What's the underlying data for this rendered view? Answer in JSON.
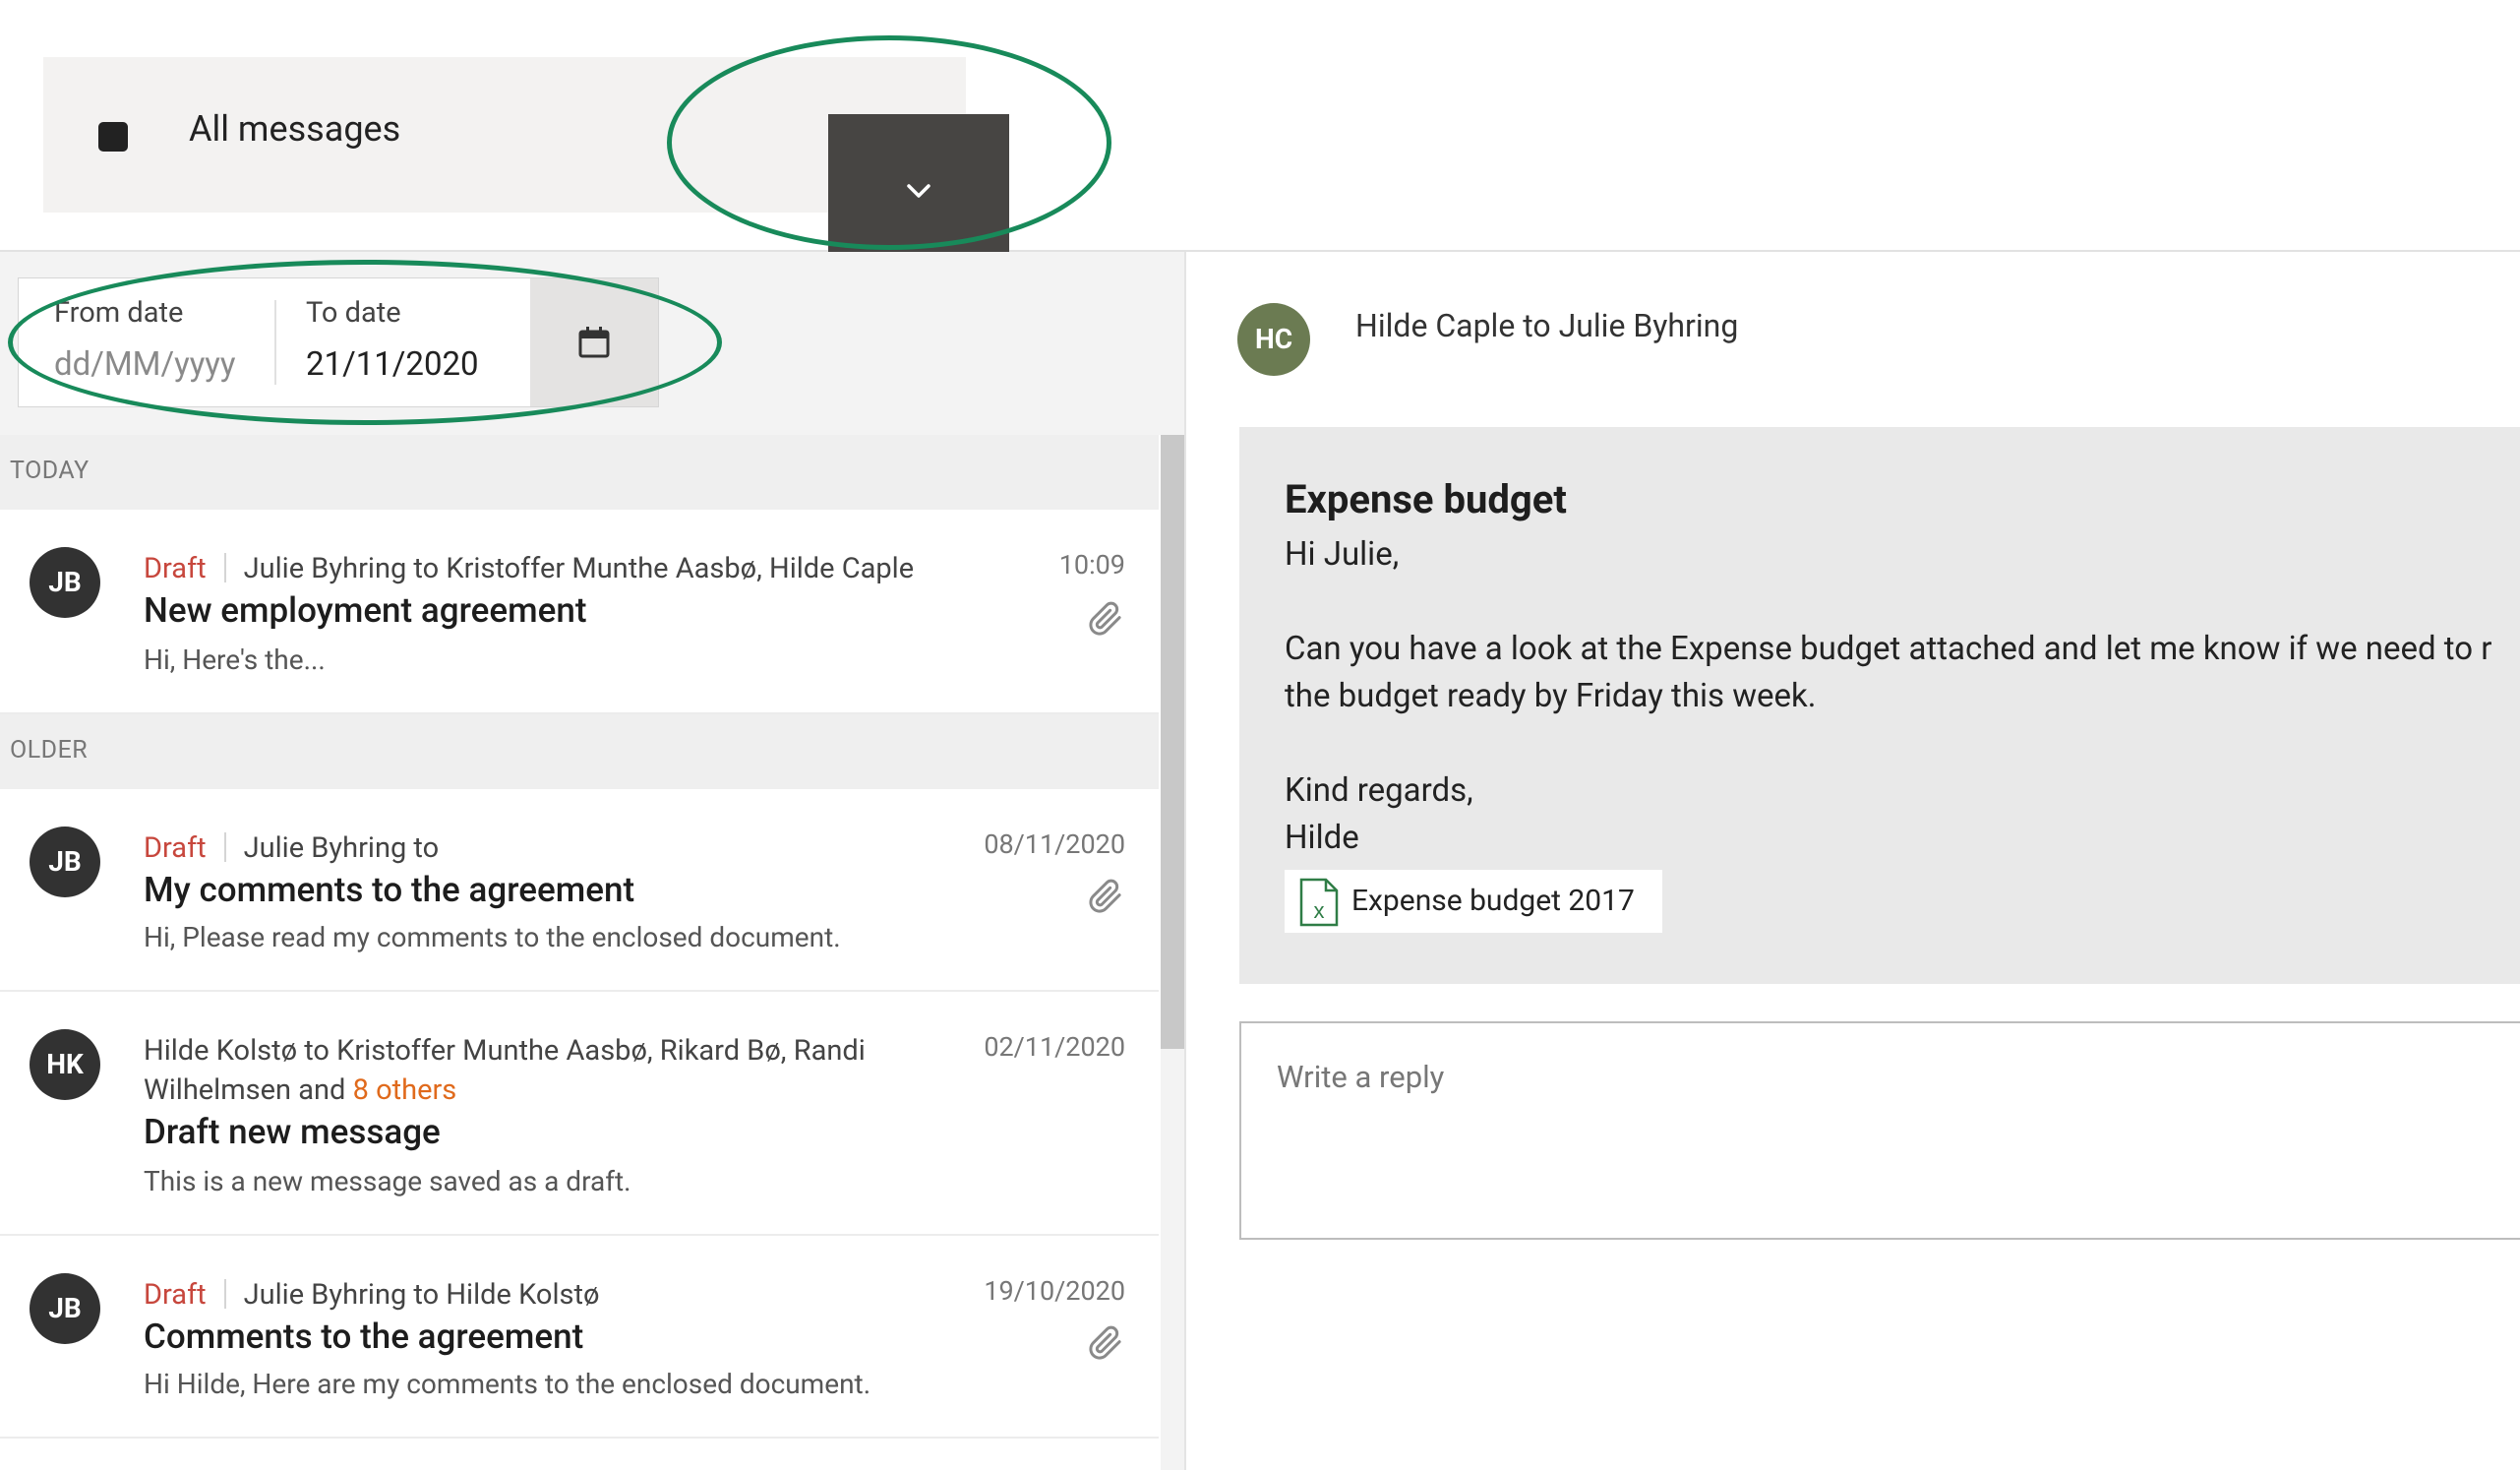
{
  "filter": {
    "label": "All messages"
  },
  "dates": {
    "from_label": "From date",
    "from_placeholder": "dd/MM/yyyy",
    "to_label": "To date",
    "to_value": "21/11/2020"
  },
  "sections": {
    "today": "TODAY",
    "older": "OLDER"
  },
  "messages": [
    {
      "initials": "JB",
      "tag": "Draft",
      "participants": "Julie Byhring to Kristoffer Munthe Aasbø, Hilde Caple",
      "subject": "New employment agreement",
      "preview": "Hi, Here's the...",
      "time": "10:09"
    },
    {
      "initials": "JB",
      "tag": "Draft",
      "participants": "Julie Byhring to",
      "subject": "My comments to the agreement",
      "preview": "Hi, Please read my comments to the enclosed document.",
      "time": "08/11/2020"
    },
    {
      "initials": "HK",
      "participants_line1": "Hilde Kolstø to Kristoffer Munthe Aasbø, Rikard Bø, Randi",
      "participants_line2": "Wilhelmsen and",
      "others": "8 others",
      "subject": "Draft new message",
      "preview": "This is a new message saved as a draft.",
      "time": "02/11/2020"
    },
    {
      "initials": "JB",
      "tag": "Draft",
      "participants": "Julie Byhring to Hilde Kolstø",
      "subject": "Comments to the agreement",
      "preview": "Hi Hilde, Here are my comments to the enclosed document.",
      "time": "19/10/2020"
    }
  ],
  "conversation": {
    "initials": "HC",
    "header": "Hilde Caple to Julie Byhring",
    "title": "Expense budget",
    "body": "Hi Julie,\n\nCan you have a look at the Expense budget attached and let me know if we need to r\nthe budget ready by Friday this week.\n\nKind regards,\nHilde",
    "attachment": "Expense budget 2017"
  },
  "reply": {
    "placeholder": "Write a reply"
  },
  "colors": {
    "draft": "#c7473d",
    "others_link": "#e06a1c",
    "annotation": "#188a5a",
    "dark_button": "#474543"
  },
  "icons": [
    "chevron-down-icon",
    "calendar-icon",
    "paperclip-icon",
    "excel-file-icon"
  ]
}
